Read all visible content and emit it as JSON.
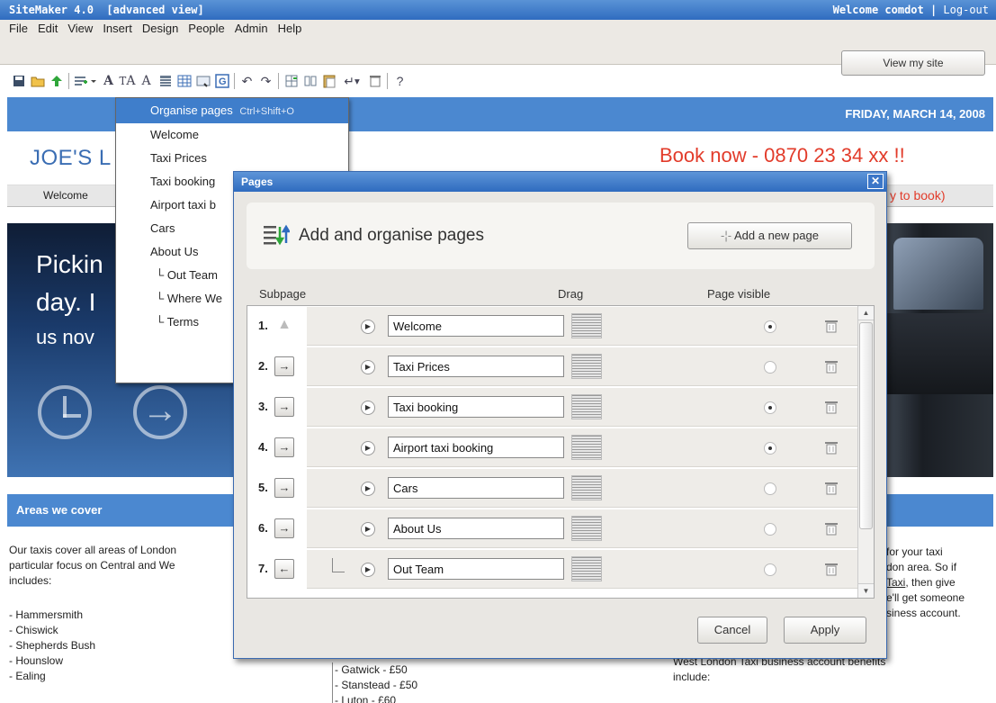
{
  "app": {
    "title": "SiteMaker 4.0",
    "mode": "[advanced view]",
    "welcome": "Welcome comdot |",
    "logout": "Log-out"
  },
  "menu": [
    "File",
    "Edit",
    "View",
    "Insert",
    "Design",
    "People",
    "Admin",
    "Help"
  ],
  "view_site": "View my site",
  "toolbar_icons": [
    "save-icon",
    "open-folder-icon",
    "publish-arrow-icon",
    "add-page-icon",
    "font-icon",
    "font-size-icon",
    "font-size-small-icon",
    "align-icon",
    "table-icon",
    "image-icon",
    "link-icon",
    "undo-icon",
    "redo-icon",
    "insert-row-icon",
    "insert-column-icon",
    "paste-icon",
    "return-icon",
    "delete-icon",
    "help-icon"
  ],
  "date": "FRIDAY, MARCH 14, 2008",
  "site": {
    "title": "JOE'S L",
    "book_now": "Book now - 0870 23 34 xx !!",
    "nav_welcome": "Welcome",
    "nav_book": "y to book)",
    "hero_lines": [
      "Pickin",
      "day. I",
      "us nov"
    ],
    "areas": "Areas we cover",
    "left_text": [
      "Our taxis cover all areas of London",
      "particular focus on Central and We",
      "includes:"
    ],
    "left_list": [
      "- Hammersmith",
      "- Chiswick",
      "- Shepherds Bush",
      "- Hounslow",
      "- Ealing"
    ],
    "mid_list": [
      "- Gatwick - £50",
      "- Stanstead - £50",
      "- Luton - £60"
    ],
    "right_text": [
      "for your taxi",
      "don area. So if",
      "Taxi",
      ", then give",
      "e'll get someone",
      "siness account."
    ],
    "right_text2": [
      "West London Taxi business account benefits",
      "include:"
    ]
  },
  "dropdown": {
    "header": "Organise pages",
    "shortcut": "Ctrl+Shift+O",
    "items": [
      "Welcome",
      "Taxi Prices",
      "Taxi booking",
      "Airport taxi b",
      "Cars",
      "About Us"
    ],
    "subitems": [
      "└ Out Team",
      "└ Where We",
      "└ Terms"
    ]
  },
  "dialog": {
    "title": "Pages",
    "close": "✕",
    "heading": "Add and organise pages",
    "add_button": "Add a new page",
    "col_subpage": "Subpage",
    "col_drag": "Drag",
    "col_visible": "Page visible",
    "cancel": "Cancel",
    "apply": "Apply",
    "rows": [
      {
        "num": "1.",
        "name": "Welcome",
        "visible": true,
        "move": "none"
      },
      {
        "num": "2.",
        "name": "Taxi Prices",
        "visible": false,
        "move": "right"
      },
      {
        "num": "3.",
        "name": "Taxi booking",
        "visible": true,
        "move": "right"
      },
      {
        "num": "4.",
        "name": "Airport taxi booking",
        "visible": true,
        "move": "right"
      },
      {
        "num": "5.",
        "name": "Cars",
        "visible": false,
        "move": "right"
      },
      {
        "num": "6.",
        "name": "About Us",
        "visible": false,
        "move": "right"
      },
      {
        "num": "7.",
        "name": "Out Team",
        "visible": false,
        "move": "left",
        "indented": true
      }
    ]
  }
}
